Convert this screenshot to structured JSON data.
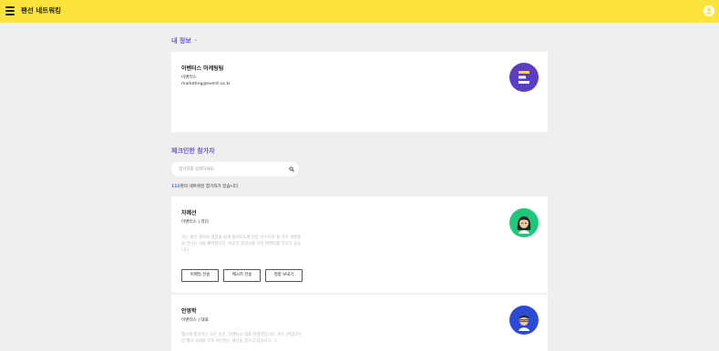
{
  "app": {
    "title": "팬선 네트워킹"
  },
  "topbar": {
    "menu_icon": "hamburger-icon",
    "account_icon": "account-circle-icon",
    "background": "#fde33d"
  },
  "my_info": {
    "section_title": "내 정보",
    "chevron": "»",
    "name": "이벤터스 마케팅팀",
    "company": "이벤터스",
    "email": "marketing@event-us.kr",
    "avatar": {
      "icon": "eventus-logo-icon",
      "color": "#5b3cc4"
    }
  },
  "checked_attendees": {
    "section_title": "체크인한 참가자",
    "search": {
      "placeholder": "참석자를 입력하세요",
      "icon": "search-icon"
    },
    "count": {
      "number": "112",
      "suffix": "명의 네트워킹 참가자가 있습니다"
    },
    "people": [
      {
        "name": "차혜선",
        "role": "이벤터스 | 리더",
        "description": "저는 좋은 행사와 경험을 쉽게 찾아오도록 만든 선수이자 좋 가진 개발형을 만나는 것을 좋아합니다. 비슷한 관심사를 가진 마케터를 만나고 싶습니다.",
        "avatar": {
          "icon": "person-avatar-icon",
          "color": "#1fc77b"
        },
        "buttons": [
          "이메일 전송",
          "메시지 전송",
          "명함 보내기"
        ]
      },
      {
        "name": "안영학",
        "role": "이벤터스 | 대표",
        "description": "행사와 참석하는 모든 순간, 이벤터스 대표 안영학입니다. 저는 관심있어만 행사 사람들 IT로 혁신하는 세상을 꿈꾸고 있습니다. :)",
        "avatar": {
          "icon": "person-avatar-icon",
          "color": "#2b4bd6"
        }
      }
    ]
  }
}
